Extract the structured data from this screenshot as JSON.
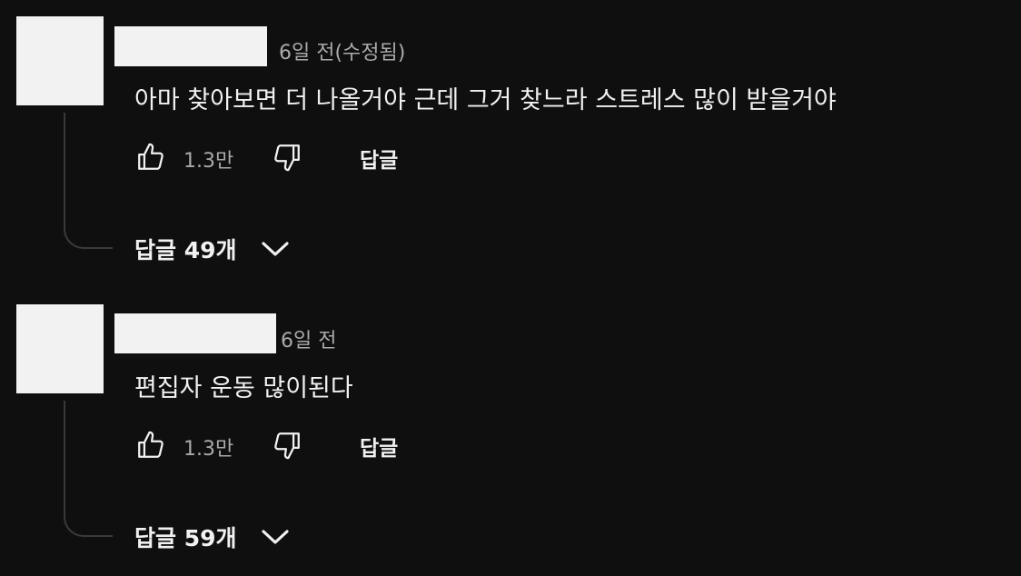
{
  "comments": [
    {
      "timestamp": "6일 전(수정됨)",
      "text": "아마 찾아보면 더 나올거야 근데 그거 찾느라 스트레스 많이 받을거야",
      "like_count": "1.3만",
      "reply_label": "답글",
      "replies_label": "답글 49개",
      "icons": {
        "like": "thumbs-up-icon",
        "dislike": "thumbs-down-icon",
        "expand": "chevron-down-icon"
      }
    },
    {
      "timestamp": "6일 전",
      "text": "편집자 운동 많이된다",
      "like_count": "1.3만",
      "reply_label": "답글",
      "replies_label": "답글 59개",
      "icons": {
        "like": "thumbs-up-icon",
        "dislike": "thumbs-down-icon",
        "expand": "chevron-down-icon"
      }
    }
  ],
  "colors": {
    "background": "#0f0f0f",
    "text_primary": "#f1f1f1",
    "text_secondary": "#aaaaaa",
    "redaction": "#f2f2f2"
  }
}
